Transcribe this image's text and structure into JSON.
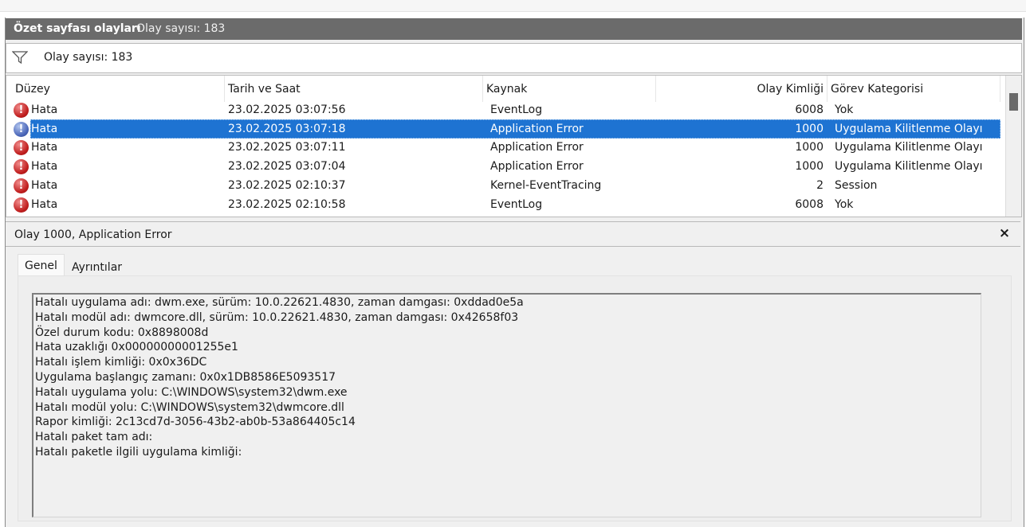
{
  "panel": {
    "title": "Özet sayfası olayları",
    "subtitle": "Olay sayısı: 183"
  },
  "filter": {
    "text": "Olay sayısı: 183",
    "icon": "filter-icon"
  },
  "grid": {
    "columns": [
      "Düzey",
      "Tarih ve Saat",
      "Kaynak",
      "Olay Kimliği",
      "Görev Kategorisi"
    ],
    "rows": [
      {
        "level": "Hata",
        "datetime": "23.02.2025 03:07:56",
        "source": "EventLog",
        "id": "6008",
        "category": "Yok",
        "selected": false
      },
      {
        "level": "Hata",
        "datetime": "23.02.2025 03:07:18",
        "source": "Application Error",
        "id": "1000",
        "category": "Uygulama Kilitlenme Olayı",
        "selected": true
      },
      {
        "level": "Hata",
        "datetime": "23.02.2025 03:07:11",
        "source": "Application Error",
        "id": "1000",
        "category": "Uygulama Kilitlenme Olayı",
        "selected": false
      },
      {
        "level": "Hata",
        "datetime": "23.02.2025 03:07:04",
        "source": "Application Error",
        "id": "1000",
        "category": "Uygulama Kilitlenme Olayı",
        "selected": false
      },
      {
        "level": "Hata",
        "datetime": "23.02.2025 02:10:37",
        "source": "Kernel-EventTracing",
        "id": "2",
        "category": "Session",
        "selected": false
      },
      {
        "level": "Hata",
        "datetime": "23.02.2025 02:10:58",
        "source": "EventLog",
        "id": "6008",
        "category": "Yok",
        "selected": false
      }
    ]
  },
  "detail": {
    "title": "Olay 1000, Application Error",
    "close": "×",
    "tabs": [
      "Genel",
      "Ayrıntılar"
    ],
    "lines": [
      "Hatalı uygulama adı: dwm.exe, sürüm: 10.0.22621.4830, zaman damgası: 0xddad0e5a",
      "Hatalı modül adı: dwmcore.dll, sürüm: 10.0.22621.4830, zaman damgası: 0x42658f03",
      "Özel durum kodu: 0x8898008d",
      "Hata uzaklığı 0x00000000001255e1",
      "Hatalı işlem kimliği: 0x0x36DC",
      "Uygulama başlangıç zamanı: 0x0x1DB8586E5093517",
      "Hatalı uygulama yolu: C:\\WINDOWS\\system32\\dwm.exe",
      "Hatalı modül yolu: C:\\WINDOWS\\system32\\dwmcore.dll",
      "Rapor kimliği: 2c13cd7d-3056-43b2-ab0b-53a864405c14",
      "Hatalı paket tam adı:",
      "Hatalı paketle ilgili uygulama kimliği:"
    ]
  },
  "colors": {
    "selection": "#1e73d2",
    "error": "#c01d1d",
    "titlebar": "#6b6b6b"
  }
}
